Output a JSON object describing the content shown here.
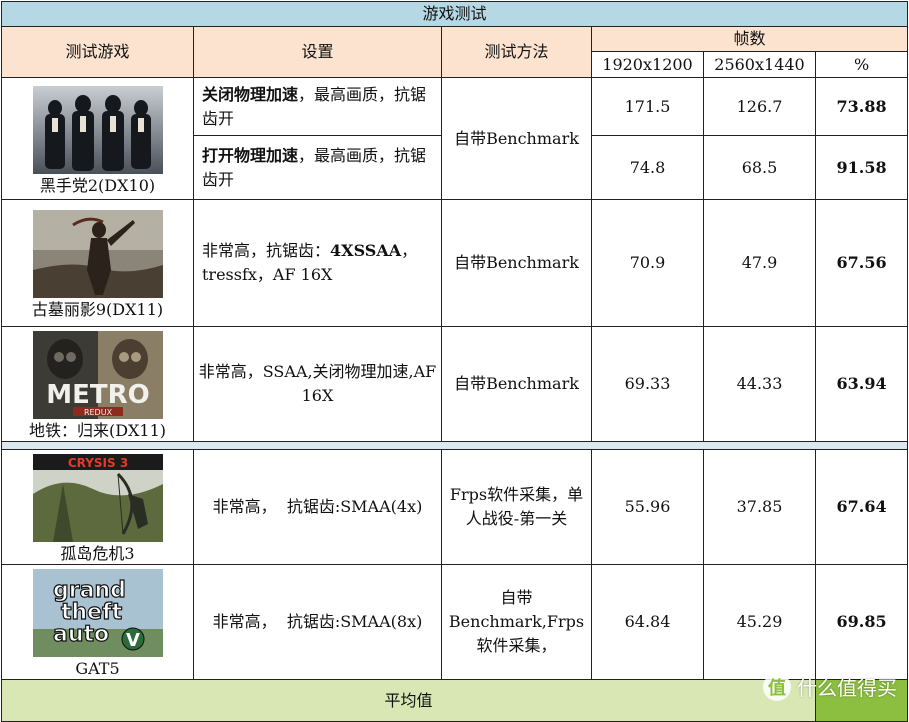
{
  "table": {
    "title": "游戏测试",
    "headers": {
      "game": "测试游戏",
      "setting": "设置",
      "method": "测试方法",
      "fps": "帧数",
      "res1": "1920x1200",
      "res2": "2560x1440",
      "pct": "%"
    },
    "mafia": {
      "name": "黑手党2(DX10)",
      "method": "自带Benchmark",
      "rows": [
        {
          "setting_bold": "关闭物理加速",
          "setting_rest": "，最高画质，抗锯齿开",
          "v1": "171.5",
          "v2": "126.7",
          "pct": "73.88"
        },
        {
          "setting_bold": "打开物理加速",
          "setting_rest": "，最高画质，抗锯齿开",
          "v1": "74.8",
          "v2": "68.5",
          "pct": "91.58"
        }
      ]
    },
    "tomb": {
      "name": "古墓丽影9(DX11)",
      "setting_a": "非常高，抗锯齿：",
      "setting_bold": "4XSSAA",
      "setting_b": "，tressfx，AF 16X",
      "method": "自带Benchmark",
      "v1": "70.9",
      "v2": "47.9",
      "pct": "67.56"
    },
    "metro": {
      "name": "地铁：归来(DX11)",
      "logo": "METRO",
      "logo_sub": "REDUX",
      "setting": "非常高，SSAA,关闭物理加速,AF 16X",
      "method": "自带Benchmark",
      "v1": "69.33",
      "v2": "44.33",
      "pct": "63.94"
    },
    "crysis": {
      "name": "孤岛危机3",
      "logo": "CRYSIS 3",
      "setting": "非常高，  抗锯齿:SMAA(4x)",
      "method": "Frps软件采集，单人战役-第一关",
      "v1": "55.96",
      "v2": "37.85",
      "pct": "67.64"
    },
    "gta": {
      "name": "GAT5",
      "logo1": "grand",
      "logo2": "theft",
      "logo3": "auto",
      "logo4": "V",
      "setting": "非常高，  抗锯齿:SMAA(8x)",
      "method": "自带Benchmark,Frps软件采集，",
      "v1": "64.84",
      "v2": "45.29",
      "pct": "69.85"
    },
    "average_label": "平均值"
  },
  "watermark": {
    "logo": "值",
    "text": "什么值得买"
  },
  "colors": {
    "title_bg": "#b6d8e5",
    "header_bg": "#fbe3cf",
    "average_bg": "#d8e7b4",
    "average_accent": "#8cbf3f"
  }
}
